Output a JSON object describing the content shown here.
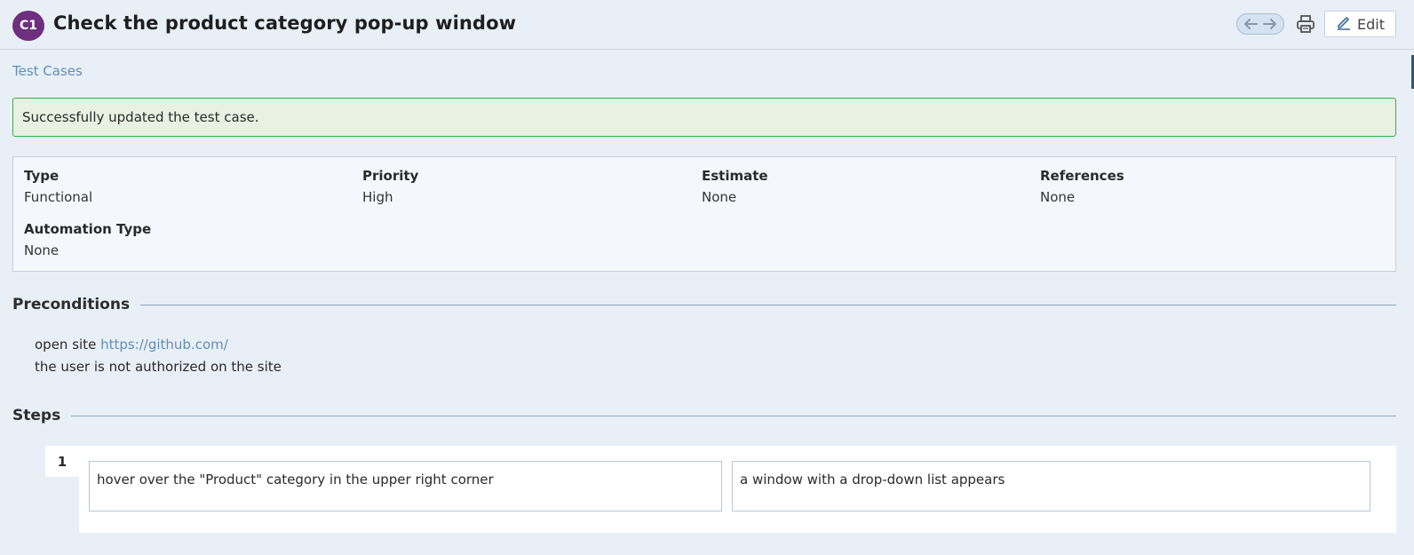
{
  "header": {
    "case_id": "C1",
    "title": "Check the product category pop-up window",
    "edit_label": "Edit"
  },
  "breadcrumb": {
    "label": "Test Cases"
  },
  "message": {
    "text": "Successfully updated the test case."
  },
  "details": {
    "type": {
      "label": "Type",
      "value": "Functional"
    },
    "priority": {
      "label": "Priority",
      "value": "High"
    },
    "estimate": {
      "label": "Estimate",
      "value": "None"
    },
    "references": {
      "label": "References",
      "value": "None"
    },
    "automation_type": {
      "label": "Automation Type",
      "value": "None"
    }
  },
  "preconditions": {
    "heading": "Preconditions",
    "line1_prefix": "open site ",
    "line1_link": "https://github.com/",
    "line2": "the user is not authorized on the site"
  },
  "steps": {
    "heading": "Steps",
    "items": [
      {
        "number": "1",
        "action": "hover over the \"Product\" category in the upper right corner",
        "expected": "a window with a drop-down list appears"
      }
    ]
  },
  "colors": {
    "badge": "#6d2f7e",
    "link": "#5f8fb8",
    "success_border": "#44a84a",
    "success_bg": "#e8f1e2",
    "background": "#e9eff7"
  },
  "icons": {
    "nav_prev": "arrow-left-icon",
    "nav_next": "arrow-right-icon",
    "print": "printer-icon",
    "edit": "pencil-icon"
  }
}
